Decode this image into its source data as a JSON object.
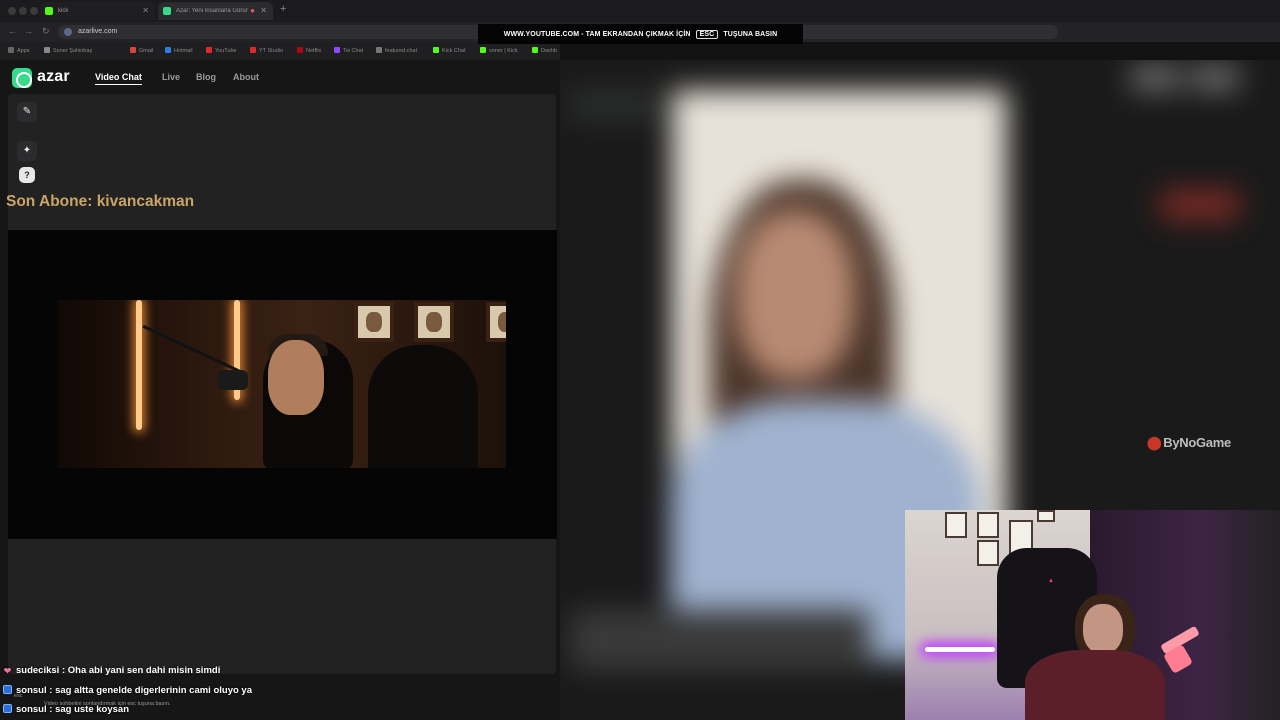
{
  "browser": {
    "tabs": [
      {
        "title": "kick",
        "favicon_color": "#53fc18"
      },
      {
        "title": "Azar: Yeni İnsanlarla Görüntülü Sohbet",
        "favicon_color": "#37d98a"
      }
    ],
    "new_tab_symbol": "+",
    "close_symbol": "✕",
    "url": "azarlive.com",
    "bookmarks": [
      "Apps",
      "Soner Şahinbaş",
      "Gmail",
      "Hotmail",
      "YouTube",
      "YT Studio",
      "Netflix",
      "Tw Chat",
      "featured.chat",
      "Kick Chat",
      "soner | Kick",
      "Dashb"
    ],
    "fullscreen_banner": {
      "prefix": "WWW.YOUTUBE.COM - TAM EKRANDAN ÇIKMAK İÇİN",
      "key": "ESC",
      "suffix": "TUŞUNA BASIN"
    }
  },
  "azar": {
    "brand": "azar",
    "nav": [
      {
        "label": "Video Chat",
        "active": true
      },
      {
        "label": "Live",
        "active": false
      },
      {
        "label": "Blog",
        "active": false
      },
      {
        "label": "About",
        "active": false
      }
    ],
    "side_buttons": [
      {
        "icon": "edit-icon",
        "glyph": "✎"
      },
      {
        "icon": "sparkle-icon",
        "glyph": "✦"
      },
      {
        "icon": "help-icon",
        "glyph": "?"
      }
    ]
  },
  "overlay": {
    "last_subscriber": "Son Abone: kivancakman",
    "brand_watermark": "ByNoGame"
  },
  "chat": [
    {
      "user": "sudeciksi",
      "message": "Oha abi yani sen dahi misin simdi",
      "badge": "heart"
    },
    {
      "user": "sonsul",
      "message": "sag altta genelde digerlerinin cami oluyo ya",
      "badge": "blue"
    },
    {
      "user": "sonsul",
      "message": "sag uste koysan",
      "badge": "blue"
    }
  ],
  "esc_hint": {
    "key": "esc",
    "text": "Video sohbetini sonlandırmak için esc tuşuna basın."
  },
  "colors": {
    "azar_green": "#37d98a",
    "subscriber_gold": "#c9a566",
    "bynogame_red": "#e83c2a"
  }
}
